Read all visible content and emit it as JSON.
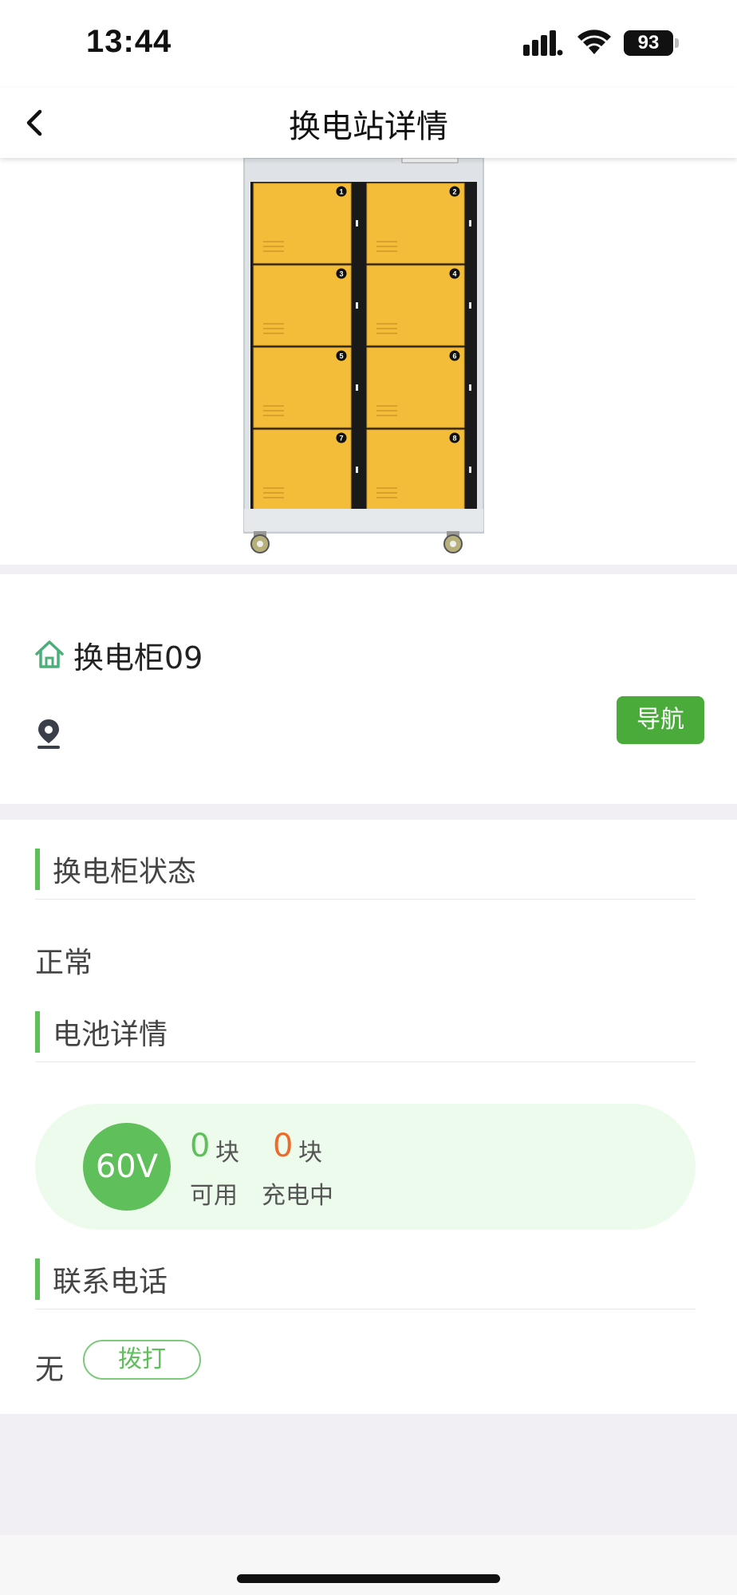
{
  "status_bar": {
    "time": "13:44",
    "battery": "93"
  },
  "nav": {
    "title": "换电站详情"
  },
  "station": {
    "name": "换电柜09",
    "navigate_label": "导航"
  },
  "cabinet_image": {
    "door_numbers": [
      "1",
      "2",
      "3",
      "4",
      "5",
      "6",
      "7",
      "8"
    ]
  },
  "sections": {
    "status_title": "换电柜状态",
    "status_value": "正常",
    "battery_title": "电池详情",
    "contact_title": "联系电话"
  },
  "battery": {
    "voltage": "60V",
    "available_count": "0",
    "charging_count": "0",
    "unit": "块",
    "available_label": "可用",
    "charging_label": "充电中"
  },
  "contact": {
    "phone": "无",
    "call_label": "拨打"
  },
  "colors": {
    "accent_green": "#5fbf5a",
    "nav_button": "#4aaa3a",
    "charging_orange": "#ee6a2a",
    "panel_bg": "#edfbec"
  }
}
